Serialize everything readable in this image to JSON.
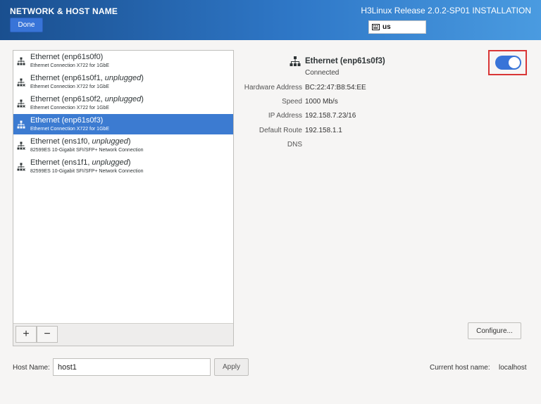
{
  "header": {
    "title": "NETWORK & HOST NAME",
    "done_label": "Done",
    "release": "H3Linux Release 2.0.2-SP01 INSTALLATION",
    "keyboard_layout": "us"
  },
  "interfaces": [
    {
      "name": "Ethernet (enp61s0f0)",
      "state": "",
      "desc": "Ethernet Connection X722 for 1GbE",
      "connected": true,
      "selected": false
    },
    {
      "name": "Ethernet (enp61s0f1, ",
      "state": "unplugged",
      "desc": "Ethernet Connection X722 for 1GbE",
      "connected": false,
      "selected": false
    },
    {
      "name": "Ethernet (enp61s0f2, ",
      "state": "unplugged",
      "desc": "Ethernet Connection X722 for 1GbE",
      "connected": false,
      "selected": false
    },
    {
      "name": "Ethernet (enp61s0f3)",
      "state": "",
      "desc": "Ethernet Connection X722 for 1GbE",
      "connected": true,
      "selected": true
    },
    {
      "name": "Ethernet (ens1f0, ",
      "state": "unplugged",
      "desc": "82599ES 10-Gigabit SFI/SFP+ Network Connection",
      "connected": false,
      "selected": false
    },
    {
      "name": "Ethernet (ens1f1, ",
      "state": "unplugged",
      "desc": "82599ES 10-Gigabit SFI/SFP+ Network Connection",
      "connected": false,
      "selected": false
    }
  ],
  "list_toolbar": {
    "add": "+",
    "remove": "−"
  },
  "detail": {
    "name": "Ethernet (enp61s0f3)",
    "status": "Connected",
    "enabled": true,
    "properties": [
      {
        "label": "Hardware Address",
        "value": "BC:22:47:B8:54:EE"
      },
      {
        "label": "Speed",
        "value": "1000 Mb/s"
      },
      {
        "label": "IP Address",
        "value": "192.158.7.23/16"
      },
      {
        "label": "Default Route",
        "value": "192.158.1.1"
      },
      {
        "label": "DNS",
        "value": ""
      }
    ],
    "configure_label": "Configure..."
  },
  "hostname": {
    "label": "Host Name:",
    "value": "host1",
    "apply_label": "Apply",
    "current_label": "Current host name:",
    "current_value": "localhost"
  },
  "colors": {
    "accent": "#3874d8",
    "selected_row": "#3c7bd1",
    "highlight_border": "#d93636"
  }
}
